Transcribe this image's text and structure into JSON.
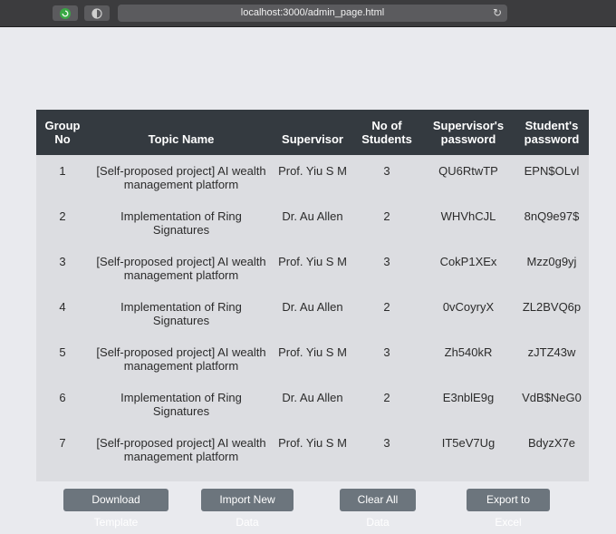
{
  "browser": {
    "url": "localhost:3000/admin_page.html"
  },
  "table": {
    "headers": [
      "Group No",
      "Topic Name",
      "Supervisor",
      "No of Students",
      "Supervisor's password",
      "Student's password"
    ],
    "rows": [
      [
        "1",
        "[Self-proposed project] AI wealth management platform",
        "Prof. Yiu S M",
        "3",
        "QU6RtwTP",
        "EPN$OLvl"
      ],
      [
        "2",
        "Implementation of Ring Signatures",
        "Dr. Au Allen",
        "2",
        "WHVhCJL",
        "8nQ9e97$"
      ],
      [
        "3",
        "[Self-proposed project] AI wealth management platform",
        "Prof. Yiu S M",
        "3",
        "CokP1XEx",
        "Mzz0g9yj"
      ],
      [
        "4",
        "Implementation of Ring Signatures",
        "Dr. Au Allen",
        "2",
        "0vCoyryX",
        "ZL2BVQ6p"
      ],
      [
        "5",
        "[Self-proposed project] AI wealth management platform",
        "Prof. Yiu S M",
        "3",
        "Zh540kR",
        "zJTZ43w"
      ],
      [
        "6",
        "Implementation of Ring Signatures",
        "Dr. Au Allen",
        "2",
        "E3nblE9g",
        "VdB$NeG0"
      ],
      [
        "7",
        "[Self-proposed project] AI wealth management platform",
        "Prof. Yiu S M",
        "3",
        "IT5eV7Ug",
        "BdyzX7e"
      ]
    ]
  },
  "buttons": {
    "download_template": "Download Template",
    "import_new_data": "Import New Data",
    "clear_all_data": "Clear All Data",
    "export_to_excel": "Export to Excel"
  },
  "colors": {
    "header_bg": "#343a40",
    "body_bg": "#dcdde1",
    "button_bg": "#6c757d",
    "page_bg": "#e9eaee"
  }
}
